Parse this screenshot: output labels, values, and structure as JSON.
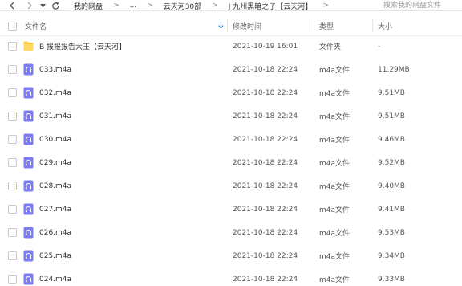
{
  "nav": {
    "back_icon": "chevron-left-icon",
    "forward_icon": "chevron-right-icon",
    "dropdown_icon": "caret-down-icon",
    "refresh_icon": "refresh-icon"
  },
  "breadcrumb": {
    "items": [
      "我的网盘",
      "...",
      "云天河30部",
      "J 九州黑暗之子【云天河】"
    ],
    "separator": ">"
  },
  "search": {
    "placeholder": "搜索我的网盘文件",
    "value": ""
  },
  "columns": {
    "name": "文件名",
    "modified": "修改时间",
    "type": "类型",
    "size": "大小"
  },
  "colors": {
    "folder": "#ffc83d",
    "audio_icon": "#7b7cf0",
    "sort_arrow": "#3a8ee6"
  },
  "files": [
    {
      "name": "B 报报报告大王【云天河】",
      "modified": "2021-10-19 16:01",
      "type": "文件夹",
      "size": "-",
      "icon": "folder-icon"
    },
    {
      "name": "033.m4a",
      "modified": "2021-10-18 22:24",
      "type": "m4a文件",
      "size": "11.29MB",
      "icon": "audio-file-icon"
    },
    {
      "name": "032.m4a",
      "modified": "2021-10-18 22:24",
      "type": "m4a文件",
      "size": "9.51MB",
      "icon": "audio-file-icon"
    },
    {
      "name": "031.m4a",
      "modified": "2021-10-18 22:24",
      "type": "m4a文件",
      "size": "9.51MB",
      "icon": "audio-file-icon"
    },
    {
      "name": "030.m4a",
      "modified": "2021-10-18 22:24",
      "type": "m4a文件",
      "size": "9.46MB",
      "icon": "audio-file-icon"
    },
    {
      "name": "029.m4a",
      "modified": "2021-10-18 22:24",
      "type": "m4a文件",
      "size": "9.52MB",
      "icon": "audio-file-icon"
    },
    {
      "name": "028.m4a",
      "modified": "2021-10-18 22:24",
      "type": "m4a文件",
      "size": "9.40MB",
      "icon": "audio-file-icon"
    },
    {
      "name": "027.m4a",
      "modified": "2021-10-18 22:24",
      "type": "m4a文件",
      "size": "9.41MB",
      "icon": "audio-file-icon"
    },
    {
      "name": "026.m4a",
      "modified": "2021-10-18 22:24",
      "type": "m4a文件",
      "size": "9.53MB",
      "icon": "audio-file-icon"
    },
    {
      "name": "025.m4a",
      "modified": "2021-10-18 22:24",
      "type": "m4a文件",
      "size": "9.34MB",
      "icon": "audio-file-icon"
    },
    {
      "name": "024.m4a",
      "modified": "2021-10-18 22:24",
      "type": "m4a文件",
      "size": "9.33MB",
      "icon": "audio-file-icon"
    }
  ]
}
